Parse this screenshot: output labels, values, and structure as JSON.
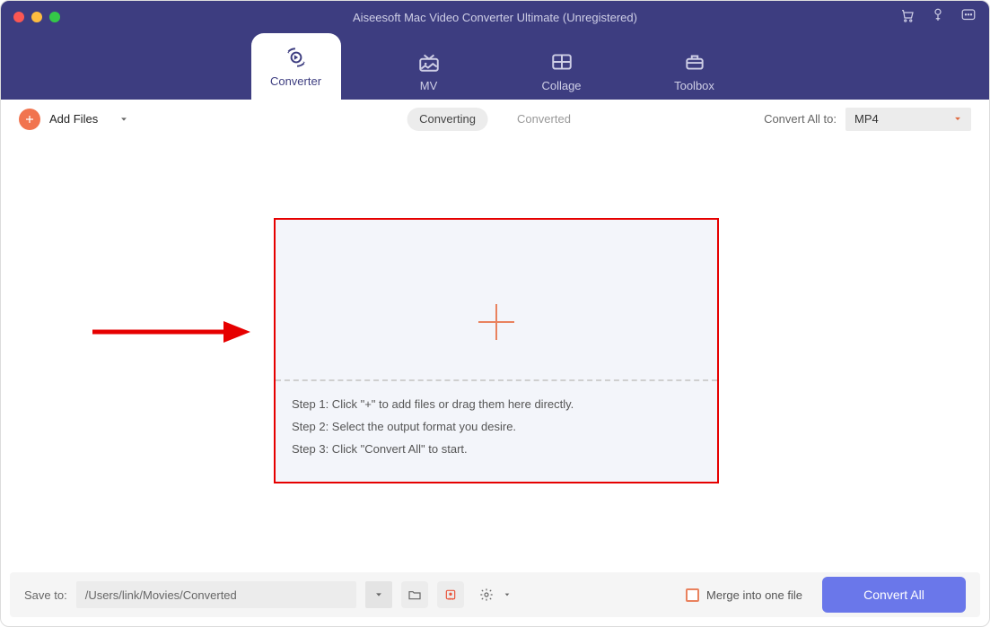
{
  "header": {
    "title": "Aiseesoft Mac Video Converter Ultimate (Unregistered)"
  },
  "nav": {
    "converter": "Converter",
    "mv": "MV",
    "collage": "Collage",
    "toolbox": "Toolbox"
  },
  "toolbar": {
    "add_files_label": "Add Files",
    "tab_converting": "Converting",
    "tab_converted": "Converted",
    "convert_all_to_label": "Convert All to:",
    "format_selected": "MP4"
  },
  "drop": {
    "step1": "Step 1: Click \"+\" to add files or drag them here directly.",
    "step2": "Step 2: Select the output format you desire.",
    "step3": "Step 3: Click \"Convert All\" to start."
  },
  "bottom": {
    "save_to_label": "Save to:",
    "save_path": "/Users/link/Movies/Converted",
    "merge_label": "Merge into one file",
    "convert_all": "Convert All"
  },
  "colors": {
    "header_bg": "#3d3d80",
    "accent_orange": "#f1744f",
    "primary_button": "#6a77ea",
    "annotation_red": "#e60000"
  }
}
